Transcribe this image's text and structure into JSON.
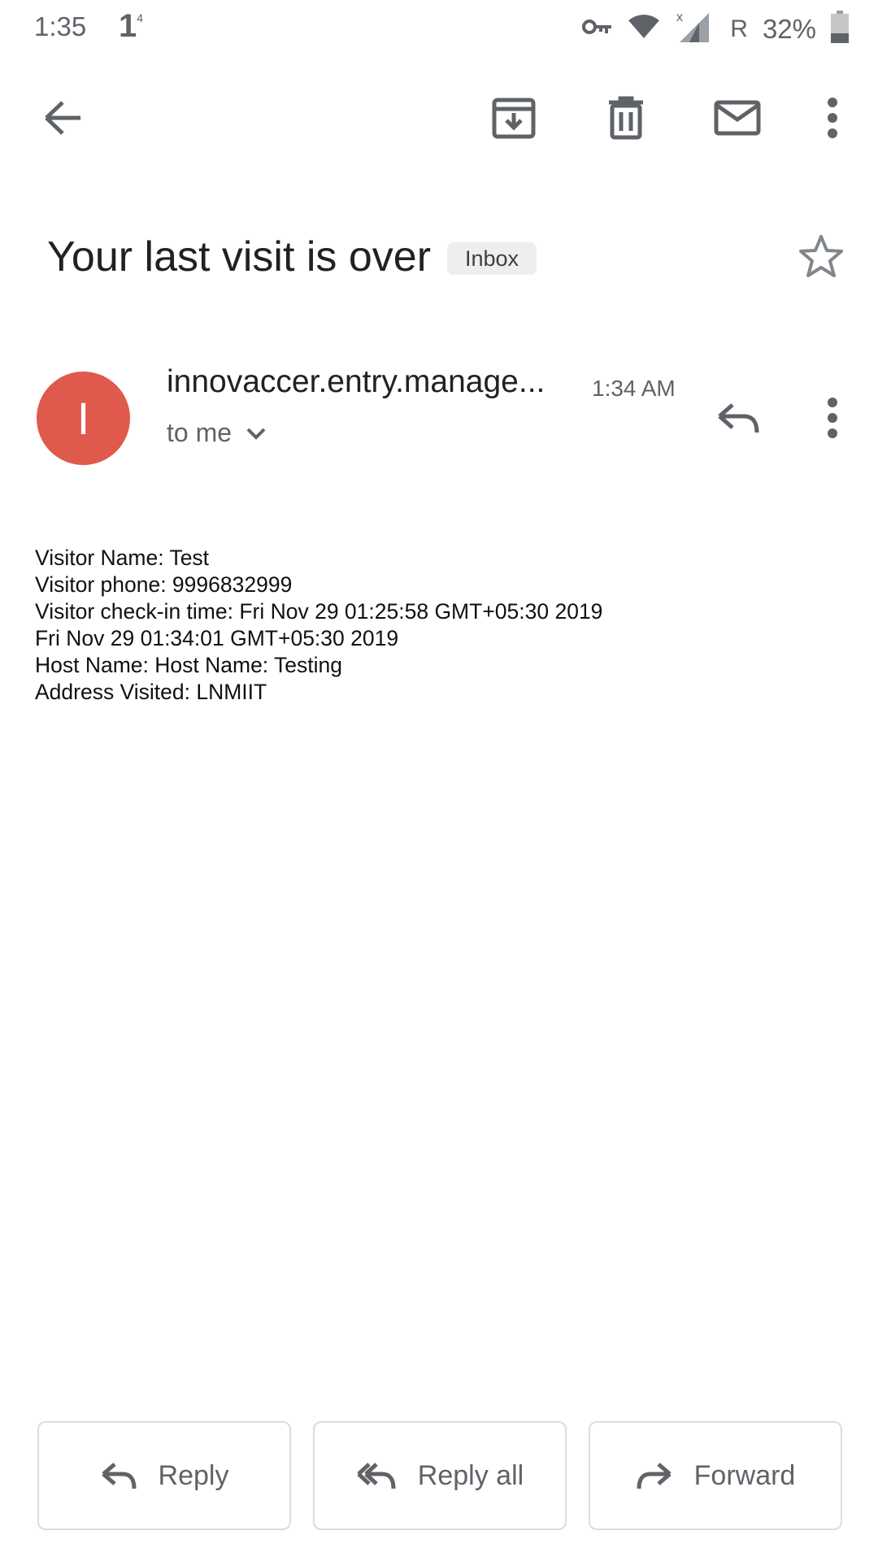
{
  "status_bar": {
    "time": "1:35",
    "notification_glyph": "1",
    "notification_sup": "4",
    "network_label": "R",
    "battery": "32%",
    "icons": [
      "vpn-key-icon",
      "wifi-icon",
      "signal-icon",
      "battery-icon"
    ]
  },
  "toolbar": {
    "icons": [
      "back-arrow-icon",
      "archive-icon",
      "delete-icon",
      "mail-icon",
      "more-vert-icon"
    ]
  },
  "email": {
    "subject": "Your last visit is over",
    "label": "Inbox",
    "sender_initial": "I",
    "sender": "innovaccer.entry.manage...",
    "time": "1:34 AM",
    "recipient": "to me",
    "avatar_color": "#e0594d",
    "body_lines": [
      "Visitor Name: Test",
      "Visitor phone: 9996832999",
      "Visitor check-in time: Fri Nov 29 01:25:58 GMT+05:30 2019",
      "Fri Nov 29 01:34:01 GMT+05:30 2019",
      "Host Name: Host Name: Testing",
      "Address Visited: LNMIIT"
    ]
  },
  "actions": {
    "reply": "Reply",
    "reply_all": "Reply all",
    "forward": "Forward"
  }
}
